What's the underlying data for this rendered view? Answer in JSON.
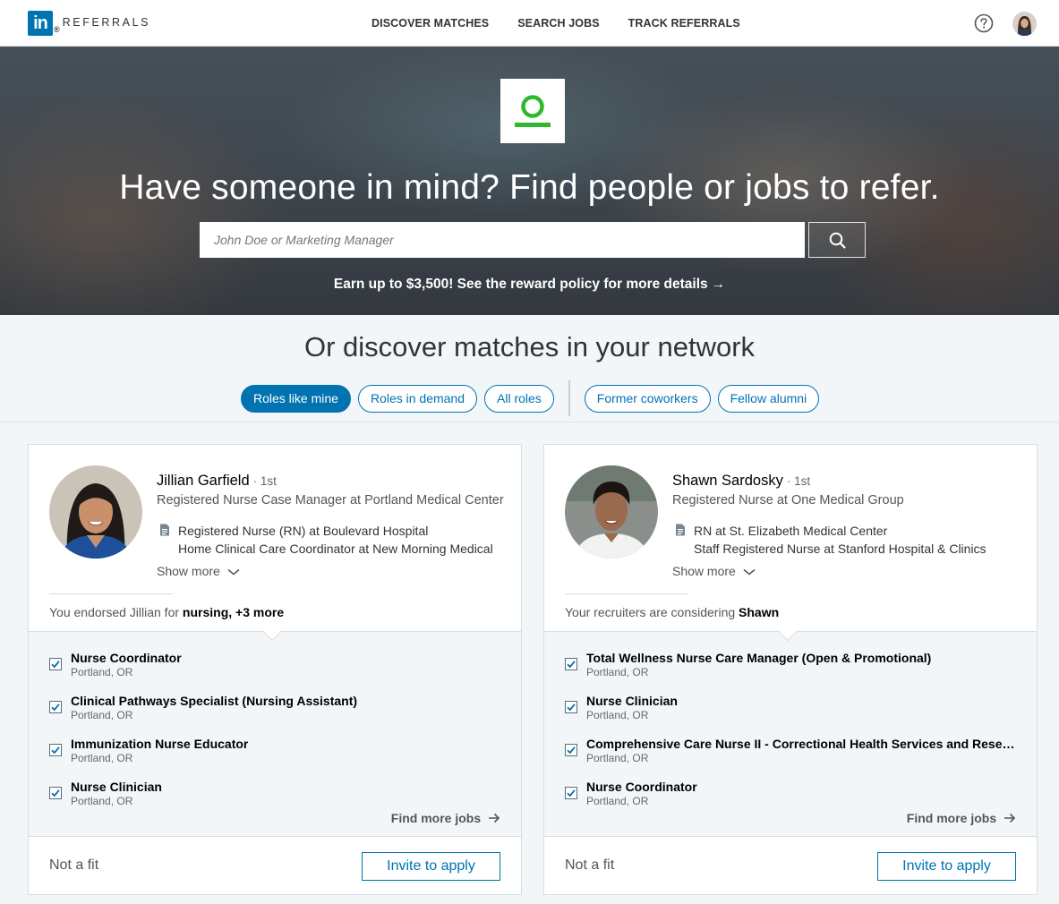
{
  "brand": {
    "logo_letters": "in",
    "logo_reg": "®",
    "product": "REFERRALS",
    "accent": "#0073b1"
  },
  "nav": {
    "links": [
      "DISCOVER MATCHES",
      "SEARCH JOBS",
      "TRACK REFERRALS"
    ],
    "help_icon": "help-circle-icon",
    "avatar_icon": "user-avatar"
  },
  "hero": {
    "title": "Have someone in mind? Find people or jobs to refer.",
    "search_placeholder": "John Doe or Marketing Manager",
    "search_icon": "search-icon",
    "reward_text": "Earn up to $3,500! See the reward policy for more details",
    "reward_arrow": "→",
    "company_logo_color": "#2eb82e"
  },
  "discover": {
    "title": "Or discover matches in your network",
    "pills": [
      "Roles like mine",
      "Roles in demand",
      "All roles",
      "Former coworkers",
      "Fellow alumni"
    ],
    "active_pill": "Roles like mine"
  },
  "cards": [
    {
      "name": "Jillian Garfield",
      "degree": "· 1st",
      "headline": "Registered Nurse Case Manager at Portland Medical Center",
      "positions": [
        "Registered Nurse (RN) at Boulevard Hospital",
        "Home Clinical Care Coordinator at New Morning Medical"
      ],
      "show_more": "Show more",
      "insight_prefix": "You endorsed Jillian for ",
      "insight_bold": "nursing, +3 more",
      "jobs": [
        {
          "title": "Nurse Coordinator",
          "location": "Portland, OR",
          "checked": true
        },
        {
          "title": "Clinical Pathways Specialist (Nursing Assistant)",
          "location": "Portland, OR",
          "checked": true
        },
        {
          "title": "Immunization Nurse Educator",
          "location": "Portland, OR",
          "checked": true
        },
        {
          "title": "Nurse Clinician",
          "location": "Portland, OR",
          "checked": true
        }
      ],
      "find_more": "Find more jobs",
      "not_fit": "Not a fit",
      "invite": "Invite to apply"
    },
    {
      "name": "Shawn Sardosky",
      "degree": "· 1st",
      "headline": "Registered Nurse at One Medical Group",
      "positions": [
        "RN at St. Elizabeth Medical Center",
        "Staff Registered Nurse at Stanford Hospital & Clinics"
      ],
      "show_more": "Show more",
      "insight_prefix": "Your recruiters are considering ",
      "insight_bold": "Shawn",
      "jobs": [
        {
          "title": "Total Wellness Nurse Care Manager (Open & Promotional)",
          "location": "Portland, OR",
          "checked": true
        },
        {
          "title": "Nurse Clinician",
          "location": "Portland, OR",
          "checked": true
        },
        {
          "title": "Comprehensive Care Nurse II - Correctional Health Services and Research",
          "location": "Portland, OR",
          "checked": true
        },
        {
          "title": "Nurse Coordinator",
          "location": "Portland, OR",
          "checked": true
        }
      ],
      "find_more": "Find more jobs",
      "not_fit": "Not a fit",
      "invite": "Invite to apply"
    }
  ]
}
